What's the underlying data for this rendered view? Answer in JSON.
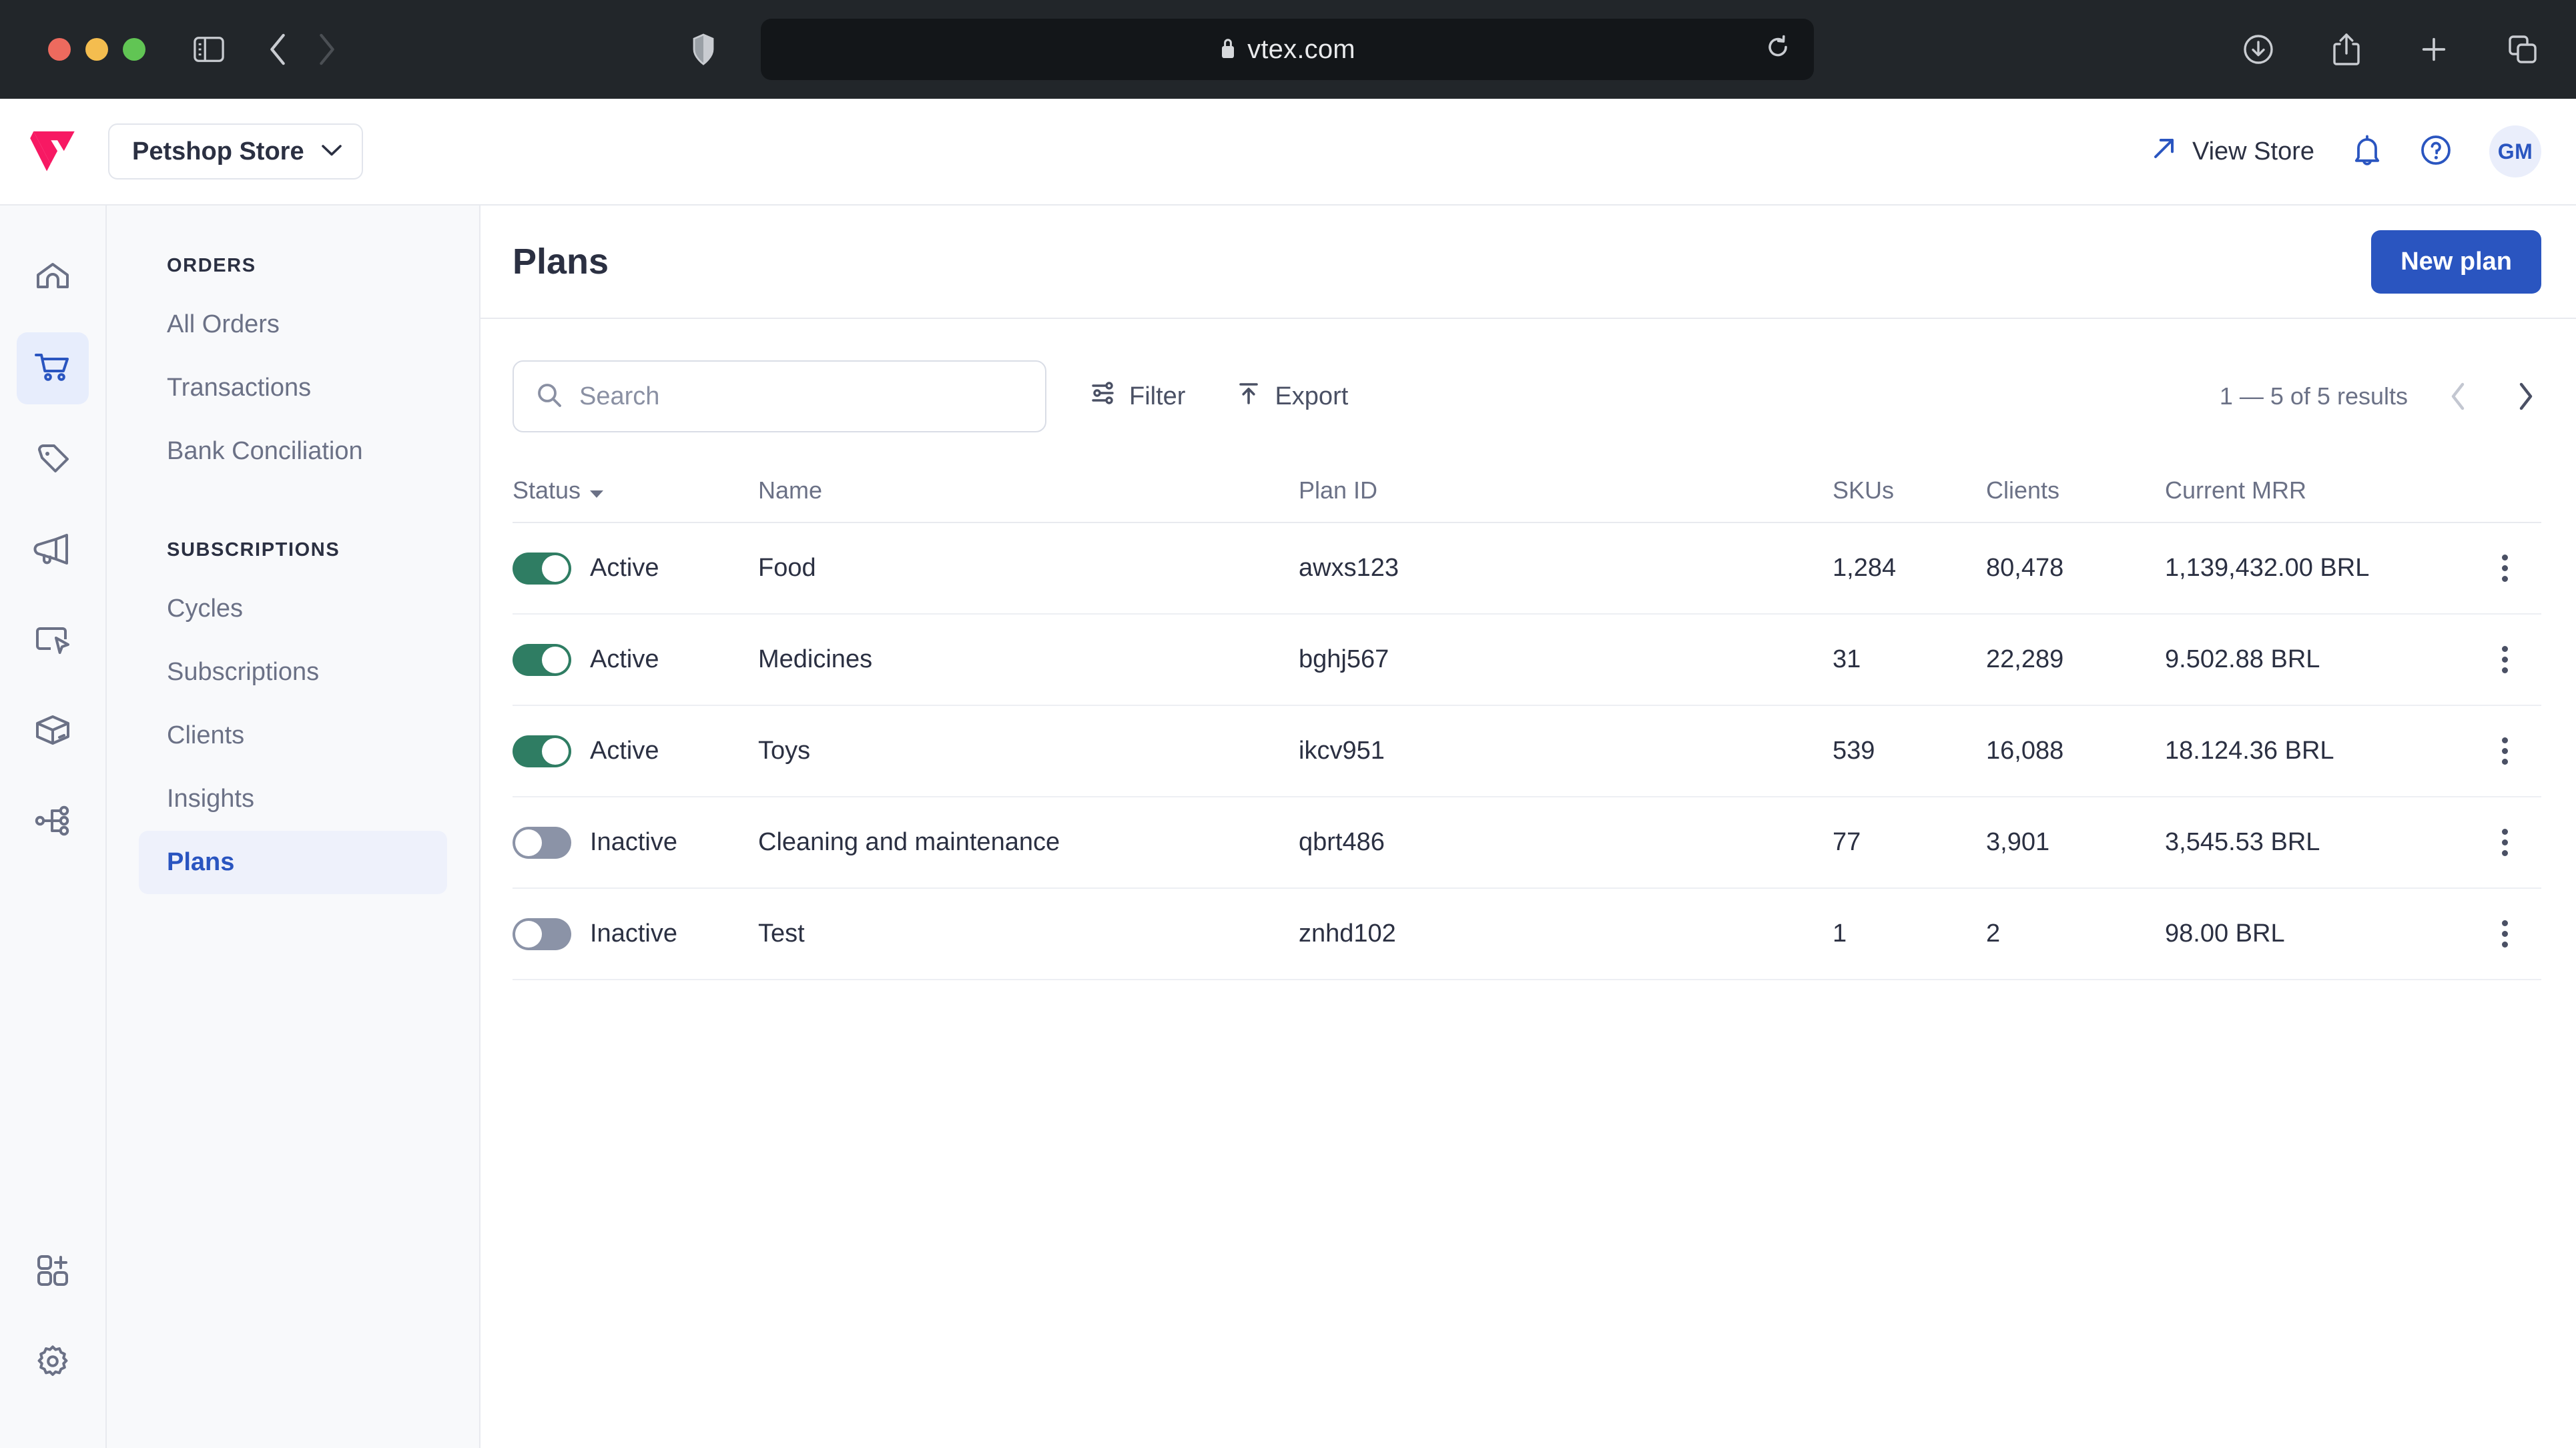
{
  "browser": {
    "url": "vtex.com",
    "lock_icon": "lock-icon",
    "shield_icon": "shield-icon",
    "reload_icon": "reload-icon",
    "sidebar_toggle_icon": "sidebar-toggle-icon",
    "back_icon": "back-arrow-icon",
    "forward_icon": "forward-arrow-icon",
    "downloads_icon": "downloads-icon",
    "share_icon": "share-icon",
    "new_tab_icon": "plus-icon",
    "tab_overview_icon": "tab-overview-icon"
  },
  "topbar": {
    "logo": "vtex-logo",
    "store_name": "Petshop Store",
    "store_chevron_icon": "chevron-down-icon",
    "view_store_label": "View Store",
    "view_store_icon": "external-link-icon",
    "notifications_icon": "bell-icon",
    "help_icon": "help-circle-icon",
    "avatar_initials": "GM"
  },
  "rail": {
    "items": [
      {
        "icon": "home-icon",
        "active": false
      },
      {
        "icon": "cart-icon",
        "active": true
      },
      {
        "icon": "tag-icon",
        "active": false
      },
      {
        "icon": "megaphone-icon",
        "active": false
      },
      {
        "icon": "storefront-cursor-icon",
        "active": false
      },
      {
        "icon": "box-icon",
        "active": false
      },
      {
        "icon": "sitemap-icon",
        "active": false
      }
    ],
    "bottom_items": [
      {
        "icon": "apps-add-icon",
        "active": false
      },
      {
        "icon": "gear-icon",
        "active": false
      }
    ]
  },
  "sidebar": {
    "sections": [
      {
        "title": "ORDERS",
        "items": [
          {
            "label": "All Orders",
            "active": false
          },
          {
            "label": "Transactions",
            "active": false
          },
          {
            "label": "Bank Conciliation",
            "active": false
          }
        ]
      },
      {
        "title": "SUBSCRIPTIONS",
        "items": [
          {
            "label": "Cycles",
            "active": false
          },
          {
            "label": "Subscriptions",
            "active": false
          },
          {
            "label": "Clients",
            "active": false
          },
          {
            "label": "Insights",
            "active": false
          },
          {
            "label": "Plans",
            "active": true
          }
        ]
      }
    ]
  },
  "page": {
    "title": "Plans",
    "new_plan_label": "New plan"
  },
  "toolbar": {
    "search_placeholder": "Search",
    "search_value": "",
    "search_icon": "search-icon",
    "filter_label": "Filter",
    "filter_icon": "filter-sliders-icon",
    "export_label": "Export",
    "export_icon": "export-upload-icon",
    "results_text": "1 — 5 of 5 results",
    "prev_icon": "chevron-left-icon",
    "next_icon": "chevron-right-icon"
  },
  "table": {
    "columns": [
      {
        "label": "Status",
        "sort_icon": "caret-down-icon"
      },
      {
        "label": "Name"
      },
      {
        "label": "Plan ID"
      },
      {
        "label": "SKUs"
      },
      {
        "label": "Clients"
      },
      {
        "label": "Current MRR"
      }
    ],
    "rows": [
      {
        "toggle": "on",
        "status": "Active",
        "name": "Food",
        "plan_id": "awxs123",
        "skus": "1,284",
        "clients": "80,478",
        "mrr": "1,139,432.00 BRL",
        "menu_icon": "kebab-menu-icon"
      },
      {
        "toggle": "on",
        "status": "Active",
        "name": "Medicines",
        "plan_id": "bghj567",
        "skus": "31",
        "clients": "22,289",
        "mrr": "9.502.88 BRL",
        "menu_icon": "kebab-menu-icon"
      },
      {
        "toggle": "on",
        "status": "Active",
        "name": "Toys",
        "plan_id": "ikcv951",
        "skus": "539",
        "clients": "16,088",
        "mrr": "18.124.36 BRL",
        "menu_icon": "kebab-menu-icon"
      },
      {
        "toggle": "off",
        "status": "Inactive",
        "name": "Cleaning and maintenance",
        "plan_id": "qbrt486",
        "skus": "77",
        "clients": "3,901",
        "mrr": "3,545.53 BRL",
        "menu_icon": "kebab-menu-icon"
      },
      {
        "toggle": "off",
        "status": "Inactive",
        "name": "Test",
        "plan_id": "znhd102",
        "skus": "1",
        "clients": "2",
        "mrr": "98.00 BRL",
        "menu_icon": "kebab-menu-icon"
      }
    ]
  },
  "colors": {
    "accent_blue": "#2a55c0",
    "brand_pink": "#f71963",
    "toggle_on": "#2f7d63",
    "toggle_off": "#8b93a7",
    "text_dark": "#2b3042",
    "text_muted": "#6b7186"
  }
}
